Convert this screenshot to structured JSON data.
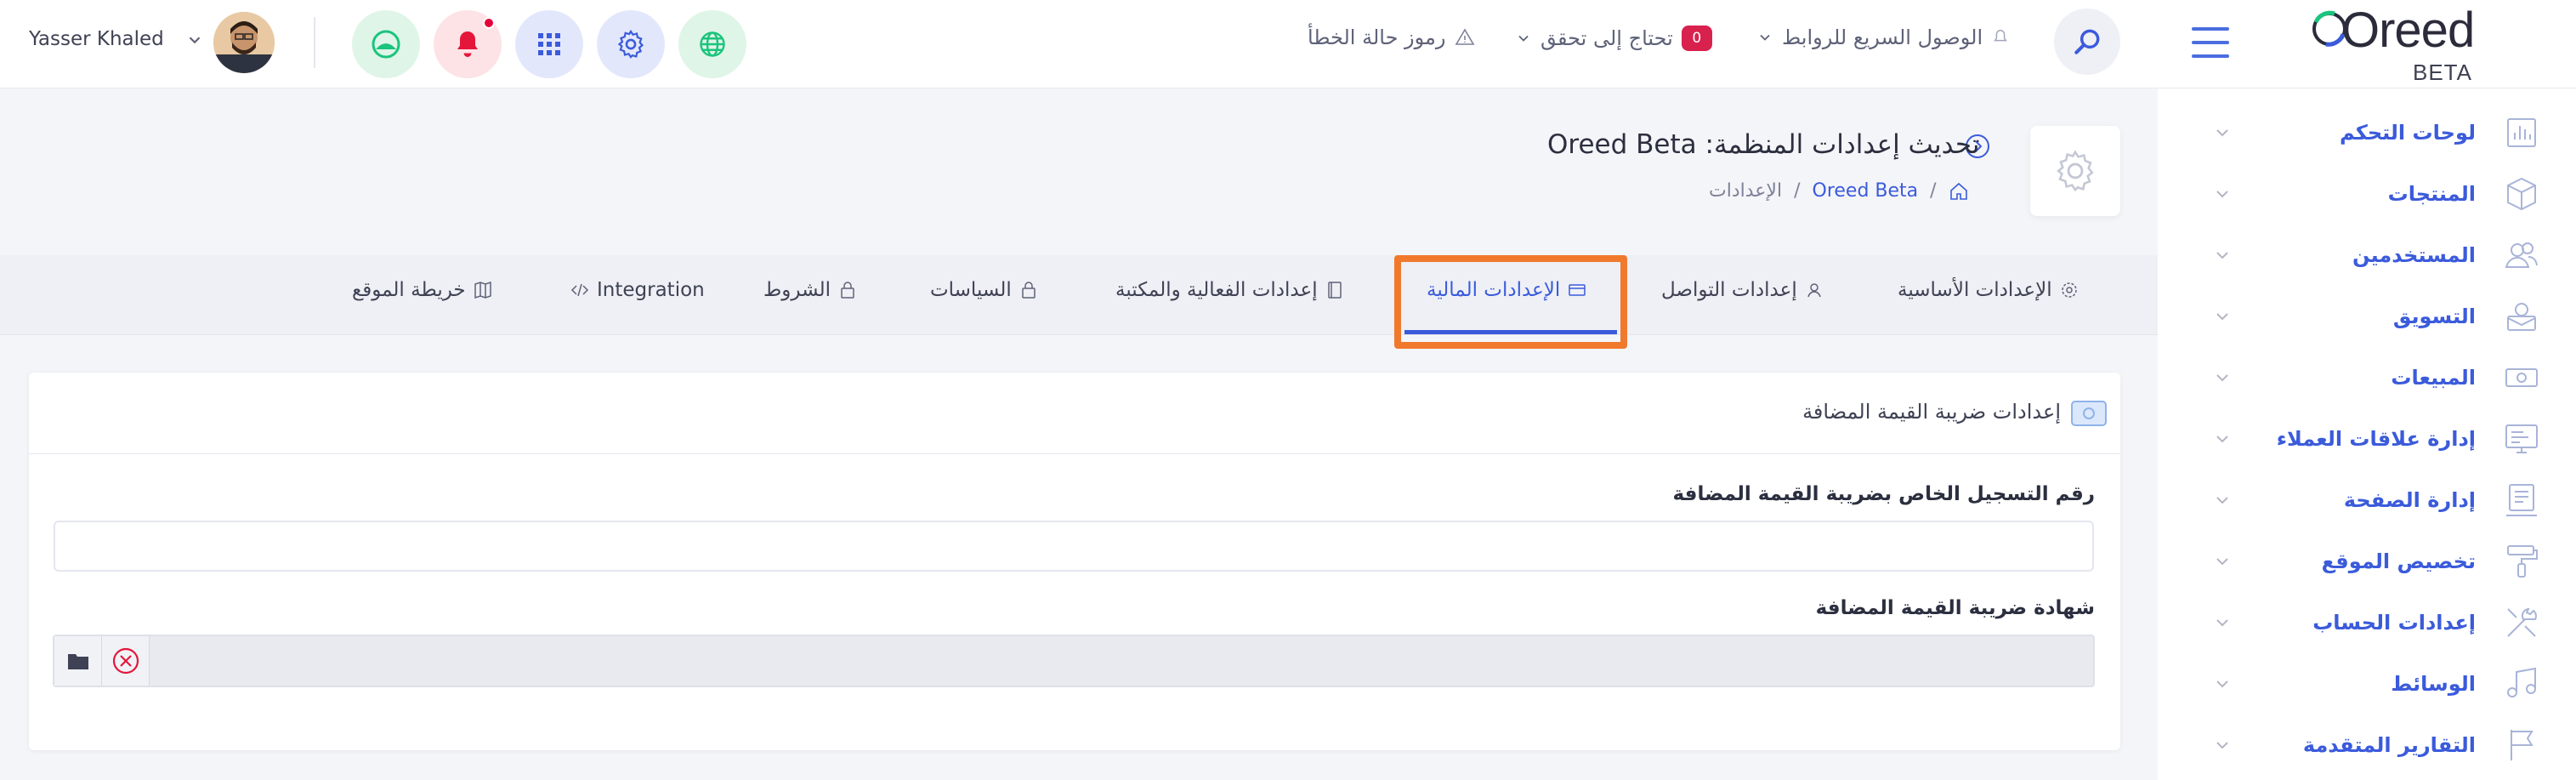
{
  "header": {
    "user_name": "Yasser Khaled",
    "error_codes": "رموز حالة الخطأ",
    "needs_verification": "تحتاج إلى تحقق",
    "verification_count": "0",
    "quick_access": "الوصول السريع للروابط"
  },
  "logo": {
    "name": "Oreed",
    "edition": "BETA"
  },
  "sidebar": {
    "items": [
      {
        "label": "لوحات التحكم",
        "icon": "chart-icon"
      },
      {
        "label": "المنتجات",
        "icon": "box-icon"
      },
      {
        "label": "المستخدمين",
        "icon": "users-icon"
      },
      {
        "label": "التسويق",
        "icon": "megaphone-icon"
      },
      {
        "label": "المبيعات",
        "icon": "money-icon"
      },
      {
        "label": "إدارة علاقات العملاء",
        "icon": "crm-icon"
      },
      {
        "label": "إدارة الصفحة",
        "icon": "page-icon"
      },
      {
        "label": "تخصيص الموقع",
        "icon": "paint-roller-icon"
      },
      {
        "label": "إعدادات الحساب",
        "icon": "tools-icon"
      },
      {
        "label": "الوسائط",
        "icon": "music-icon"
      },
      {
        "label": "التقارير المتقدمة",
        "icon": "flag-icon"
      }
    ]
  },
  "page": {
    "title": "تحديث إعدادات المنظمة: Oreed Beta",
    "breadcrumb": {
      "org": "Oreed Beta",
      "current": "الإعدادات"
    }
  },
  "tabs": [
    {
      "label": "الإعدادات الأساسية",
      "icon": "gear-icon"
    },
    {
      "label": "إعدادات التواصل",
      "icon": "contact-icon"
    },
    {
      "label": "الإعدادات المالية",
      "icon": "wallet-icon",
      "active": true
    },
    {
      "label": "إعدادات الفعالية والمكتبة",
      "icon": "book-icon"
    },
    {
      "label": "السياسات",
      "icon": "lock-icon"
    },
    {
      "label": "الشروط",
      "icon": "lock-icon"
    },
    {
      "label": "Integration",
      "icon": "code-icon"
    },
    {
      "label": "خريطة الموقع",
      "icon": "map-icon"
    }
  ],
  "vat_section": {
    "title": "إعدادات ضريبة القيمة المضافة",
    "registration_label": "رقم التسجيل الخاص بضريبة القيمة المضافة",
    "registration_value": "",
    "certificate_label": "شهادة ضريبة القيمة المضافة"
  },
  "colors": {
    "accent": "#3b5bdb",
    "highlight_frame": "#f0792c",
    "badge": "#d9214e"
  }
}
